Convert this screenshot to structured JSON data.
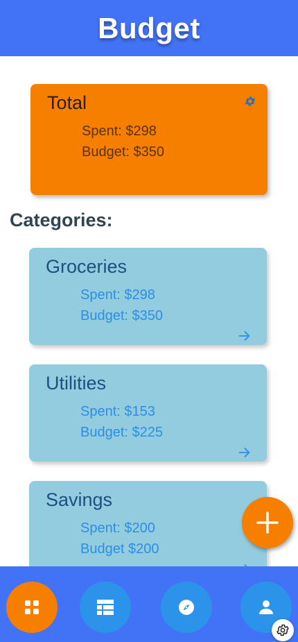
{
  "header": {
    "title": "Budget"
  },
  "total": {
    "title": "Total",
    "spent": "Spent: $298",
    "budget": "Budget: $350"
  },
  "section": {
    "title": "Categories:"
  },
  "categories": [
    {
      "name": "Groceries",
      "spent": "Spent: $298",
      "budget": "Budget: $350"
    },
    {
      "name": "Utilities",
      "spent": "Spent: $153",
      "budget": "Budget: $225"
    },
    {
      "name": "Savings",
      "spent": "Spent: $200",
      "budget": "Budget $200"
    }
  ],
  "fab": {
    "icon": "plus-icon"
  },
  "nav": {
    "items": [
      {
        "icon": "dashboard-grid-icon",
        "active": true
      },
      {
        "icon": "list-view-icon",
        "active": false
      },
      {
        "icon": "compass-icon",
        "active": false
      },
      {
        "icon": "person-icon",
        "active": false
      }
    ]
  },
  "colors": {
    "header": "#4272f5",
    "accent_orange": "#f77f00",
    "card_blue": "#93cbdf",
    "nav_button": "#2b93ea"
  }
}
